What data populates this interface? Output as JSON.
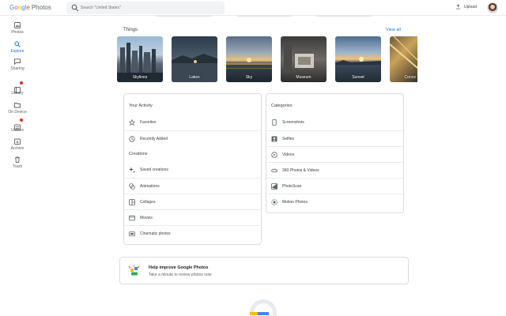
{
  "header": {
    "logo_parts": [
      "G",
      "o",
      "o",
      "g",
      "l",
      "e"
    ],
    "logo_photos": "Photos",
    "search_placeholder": "Search \"United States\"",
    "upload_label": "Upload"
  },
  "sidebar": {
    "items": [
      {
        "label": "Photos",
        "icon": "photos-icon"
      },
      {
        "label": "Explore",
        "icon": "search-icon",
        "active": true
      },
      {
        "label": "Sharing",
        "icon": "sharing-icon"
      },
      {
        "label": "Library",
        "icon": "library-icon",
        "badge": true
      },
      {
        "label": "On Device",
        "icon": "folder-icon"
      },
      {
        "label": "Utilities",
        "icon": "utilities-icon",
        "badge": true
      },
      {
        "label": "Archive",
        "icon": "archive-icon"
      },
      {
        "label": "Trash",
        "icon": "trash-icon"
      }
    ]
  },
  "things": {
    "title": "Things",
    "view_all": "View all",
    "items": [
      {
        "label": "Skylines"
      },
      {
        "label": "Lakes"
      },
      {
        "label": "Sky"
      },
      {
        "label": "Museum"
      },
      {
        "label": "Sunset"
      },
      {
        "label": "Conce"
      }
    ]
  },
  "activity": {
    "title": "Your Activity",
    "items": [
      {
        "label": "Favorites",
        "icon": "star-icon"
      },
      {
        "label": "Recently Added",
        "icon": "clock-icon"
      }
    ],
    "creations_title": "Creations",
    "creations": [
      {
        "label": "Saved creations",
        "icon": "sparkle-icon"
      },
      {
        "label": "Animations",
        "icon": "animation-icon"
      },
      {
        "label": "Collages",
        "icon": "collage-icon"
      },
      {
        "label": "Movies",
        "icon": "movie-icon"
      },
      {
        "label": "Cinematic photos",
        "icon": "cinematic-icon"
      }
    ]
  },
  "categories": {
    "title": "Categories",
    "items": [
      {
        "label": "Screenshots",
        "icon": "phone-icon"
      },
      {
        "label": "Selfies",
        "icon": "selfie-icon"
      },
      {
        "label": "Videos",
        "icon": "play-icon"
      },
      {
        "label": "360 Photos & Videos",
        "icon": "panorama-icon"
      },
      {
        "label": "PhotoScan",
        "icon": "photoscan-icon"
      },
      {
        "label": "Motion Photos",
        "icon": "motion-icon"
      }
    ]
  },
  "help": {
    "title": "Help improve Google Photos",
    "subtitle": "Take a minute to review photos now"
  },
  "colors": {
    "accent": "#1a73e8",
    "border": "#dadce0",
    "badge": "#d93025"
  }
}
